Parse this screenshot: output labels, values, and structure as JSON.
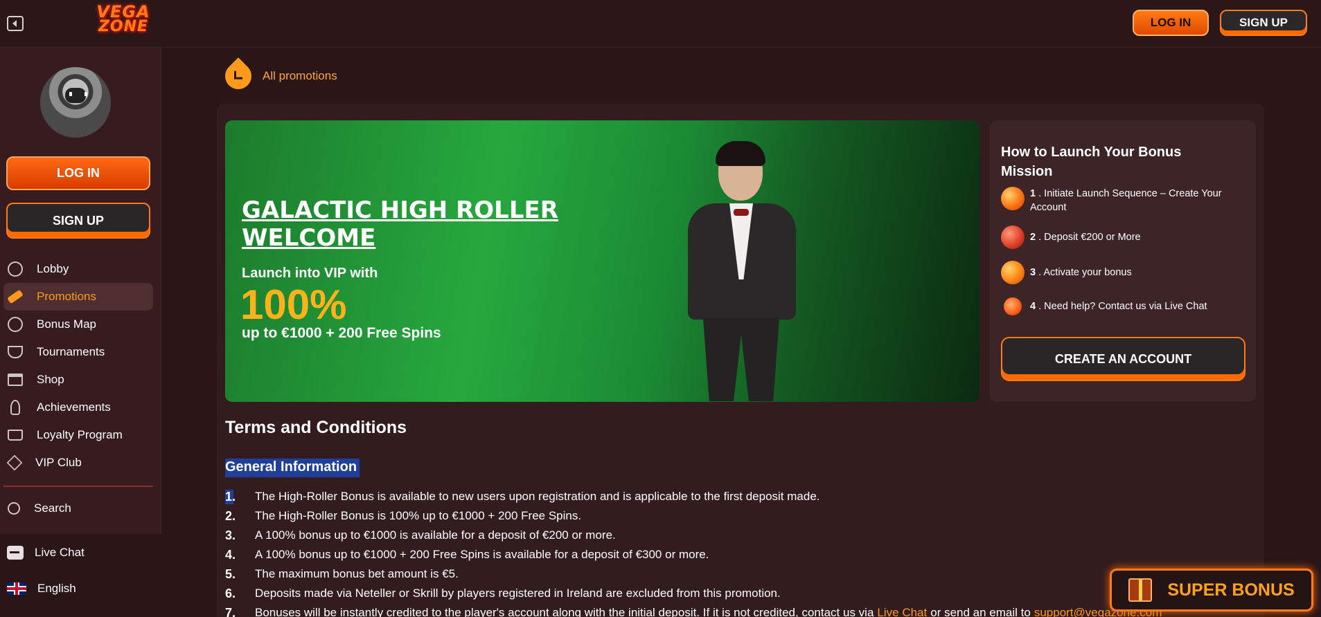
{
  "header": {
    "logo_line1": "VEGA",
    "logo_line2": "ZONE",
    "login_label": "LOG IN",
    "signup_label": "SIGN UP"
  },
  "sidebar": {
    "login_label": "LOG IN",
    "signup_label": "SIGN UP",
    "items": [
      {
        "label": "Lobby",
        "icon": "lobby-icon"
      },
      {
        "label": "Promotions",
        "icon": "telescope-icon",
        "active": true
      },
      {
        "label": "Bonus Map",
        "icon": "bonus-map-icon"
      },
      {
        "label": "Tournaments",
        "icon": "trophy-icon"
      },
      {
        "label": "Shop",
        "icon": "shop-icon"
      },
      {
        "label": "Achievements",
        "icon": "rocket-icon"
      },
      {
        "label": "Loyalty Program",
        "icon": "crown-icon"
      },
      {
        "label": "VIP Club",
        "icon": "gem-icon"
      }
    ],
    "search_label": "Search",
    "live_chat_label": "Live Chat",
    "language_label": "English"
  },
  "main": {
    "back_label": "All promotions",
    "hero": {
      "title": "GALACTIC HIGH ROLLER WELCOME",
      "subtitle": "Launch into VIP with",
      "percent": "100%",
      "amount": "up to €1000 + 200 Free Spins"
    },
    "howto": {
      "title": "How to Launch Your Bonus Mission",
      "steps": [
        {
          "num": "1",
          "text": "Initiate Launch Sequence – Create Your Account"
        },
        {
          "num": "2",
          "text": "Deposit €200 or More"
        },
        {
          "num": "3",
          "text": "Activate your bonus"
        },
        {
          "num": "4",
          "text": "Need help? Contact us via Live Chat"
        }
      ],
      "cta_label": "CREATE AN ACCOUNT"
    },
    "terms_title": "Terms and Conditions",
    "general_title": "General Information",
    "terms": [
      {
        "num": "1.",
        "text": "The High-Roller Bonus is available to new users upon registration and is applicable to the first deposit made."
      },
      {
        "num": "2.",
        "text": "The High-Roller Bonus is 100% up to €1000 + 200 Free Spins."
      },
      {
        "num": "3.",
        "text": "A 100% bonus up to €1000 is available for a deposit of €200 or more."
      },
      {
        "num": "4.",
        "text": "A 100% bonus up to €1000 + 200 Free Spins is available for a deposit of €300 or more."
      },
      {
        "num": "5.",
        "text": "The maximum bonus bet amount is €5."
      },
      {
        "num": "6.",
        "text": "Deposits made via Neteller or Skrill by players registered in Ireland are excluded from this promotion."
      },
      {
        "num": "7.",
        "text_before": "Bonuses will be instantly credited to the player's account along with the initial deposit. If it is not credited, contact us via",
        "link1": "Live Chat",
        "text_middle": "or send an email to",
        "link2": "support@vegazone.com"
      }
    ]
  },
  "super_bonus_label": "SUPER BONUS",
  "colors": {
    "accent": "#ff7a1a",
    "background": "#2a1517",
    "hero_green": "#26a83e",
    "highlight": "#1f3f9a"
  }
}
